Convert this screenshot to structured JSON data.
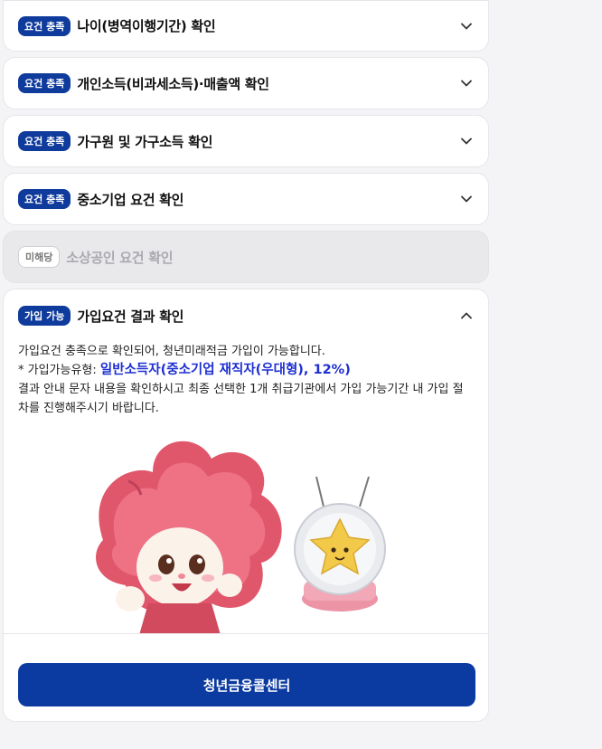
{
  "requirements": [
    {
      "badge": "요건 충족",
      "title": "나이(병역이행기간) 확인",
      "status": "met"
    },
    {
      "badge": "요건 충족",
      "title": "개인소득(비과세소득)·매출액 확인",
      "status": "met"
    },
    {
      "badge": "요건 충족",
      "title": "가구원 및 가구소득 확인",
      "status": "met"
    },
    {
      "badge": "요건 충족",
      "title": "중소기업 요건 확인",
      "status": "met"
    },
    {
      "badge": "미해당",
      "title": "소상공인 요건 확인",
      "status": "na"
    }
  ],
  "result": {
    "badge": "가입 가능",
    "title": "가입요건 결과 확인",
    "line1": "가입요건 충족으로 확인되어, 청년미래적금 가입이 가능합니다.",
    "type_prefix": "* 가입가능유형: ",
    "type_value": "일반소득자(중소기업 재직자(우대형), 12%)",
    "line3": "결과 안내 문자 내용을 확인하시고 최종 선택한 1개 취급기관에서 가입 가능기간 내 가입 절차를 진행해주시기 바랍니다."
  },
  "cta": {
    "label": "청년금융콜센터"
  },
  "colors": {
    "badge_bg": "#0f3b9c",
    "button_bg": "#0b3aa0",
    "highlight": "#1d2fd1"
  },
  "icons": {
    "collapsed": "chevron-down-icon",
    "expanded": "chevron-up-icon"
  }
}
